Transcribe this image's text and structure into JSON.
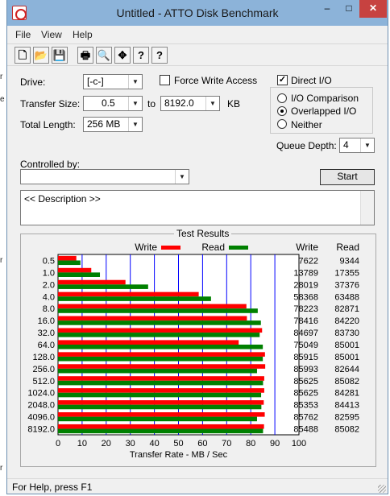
{
  "window": {
    "title": "Untitled - ATTO Disk Benchmark"
  },
  "window_buttons": {
    "minimize": "–",
    "maximize": "□",
    "close": "✕"
  },
  "menu": [
    "File",
    "View",
    "Help"
  ],
  "toolbar": [
    {
      "icon": "new-document-icon",
      "glyph": "🗋"
    },
    {
      "icon": "open-folder-icon",
      "glyph": "📂"
    },
    {
      "icon": "save-icon",
      "glyph": "💾"
    },
    {
      "icon": "print-icon",
      "glyph": "🖶"
    },
    {
      "icon": "print-preview-icon",
      "glyph": "🔍"
    },
    {
      "icon": "move-icon",
      "glyph": "✥"
    },
    {
      "icon": "help-icon",
      "glyph": "?"
    },
    {
      "icon": "context-help-icon",
      "glyph": "?"
    }
  ],
  "settings": {
    "drive_label": "Drive:",
    "drive_value": "[-c-]",
    "force_write_label": "Force Write Access",
    "force_write_checked": false,
    "direct_io_label": "Direct I/O",
    "direct_io_checked": true,
    "transfer_size_label": "Transfer Size:",
    "transfer_from": "0.5",
    "to_label": "to",
    "transfer_to": "8192.0",
    "kb_label": "KB",
    "total_length_label": "Total Length:",
    "total_length_value": "256 MB",
    "io_options": [
      {
        "label": "I/O Comparison",
        "selected": false
      },
      {
        "label": "Overlapped I/O",
        "selected": true
      },
      {
        "label": "Neither",
        "selected": false
      }
    ],
    "queue_depth_label": "Queue Depth:",
    "queue_depth_value": "4",
    "controlled_by_label": "Controlled by:",
    "controlled_by_value": "",
    "start_label": "Start",
    "description": "<< Description >>"
  },
  "colors": {
    "write": "#ff0000",
    "read": "#008000",
    "grid": "#0000ff"
  },
  "chart_data": {
    "type": "bar",
    "title": "Test Results",
    "orientation": "horizontal",
    "xlabel": "Transfer Rate - MB / Sec",
    "xlim": [
      0,
      100
    ],
    "xticks": [
      0,
      10,
      20,
      30,
      40,
      50,
      60,
      70,
      80,
      90,
      100
    ],
    "legend": [
      "Write",
      "Read"
    ],
    "legend_placement": "top",
    "column_headers": {
      "write": "Write",
      "read": "Read"
    },
    "categories": [
      "0.5",
      "1.0",
      "2.0",
      "4.0",
      "8.0",
      "16.0",
      "32.0",
      "64.0",
      "128.0",
      "256.0",
      "512.0",
      "1024.0",
      "2048.0",
      "4096.0",
      "8192.0"
    ],
    "series": [
      {
        "name": "Write",
        "values": [
          7.6,
          13.8,
          28.0,
          58.4,
          78.2,
          78.4,
          84.7,
          75.0,
          85.9,
          86.0,
          85.6,
          85.6,
          85.4,
          85.8,
          85.5
        ]
      },
      {
        "name": "Read",
        "values": [
          9.3,
          17.4,
          37.4,
          63.5,
          82.9,
          84.2,
          83.7,
          85.0,
          85.0,
          82.6,
          85.1,
          84.3,
          84.4,
          82.6,
          85.1
        ]
      }
    ],
    "write_numbers": [
      "7622",
      "13789",
      "28019",
      "58368",
      "78223",
      "78416",
      "84697",
      "75049",
      "85915",
      "85993",
      "85625",
      "85625",
      "85353",
      "85762",
      "85488"
    ],
    "read_numbers": [
      "9344",
      "17355",
      "37376",
      "63488",
      "82871",
      "84220",
      "83730",
      "85001",
      "85001",
      "82644",
      "85082",
      "84281",
      "84413",
      "82595",
      "85082"
    ]
  },
  "statusbar": {
    "text": "For Help, press F1"
  }
}
